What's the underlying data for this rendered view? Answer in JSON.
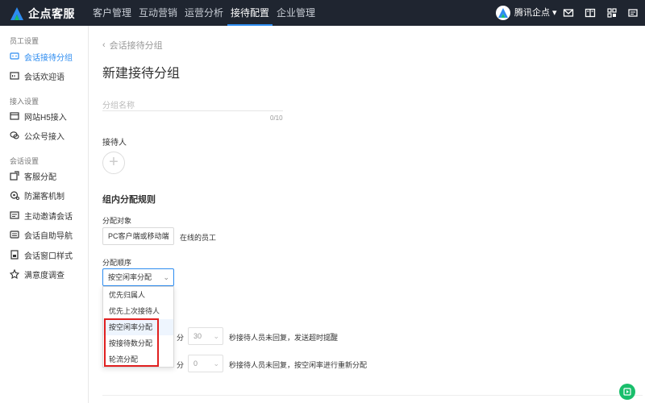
{
  "brand": "企点客服",
  "nav": [
    {
      "label": "客户管理",
      "active": false
    },
    {
      "label": "互动营销",
      "active": false
    },
    {
      "label": "运营分析",
      "active": false
    },
    {
      "label": "接待配置",
      "active": true
    },
    {
      "label": "企业管理",
      "active": false
    }
  ],
  "user": {
    "name": "腾讯企点 ▾"
  },
  "sidebar": {
    "sections": [
      {
        "title": "员工设置",
        "items": [
          {
            "label": "会话接待分组",
            "icon": "chat-group-icon",
            "active": true
          },
          {
            "label": "会话欢迎语",
            "icon": "welcome-message-icon",
            "active": false
          }
        ]
      },
      {
        "title": "接入设置",
        "items": [
          {
            "label": "网站H5接入",
            "icon": "website-icon",
            "active": false
          },
          {
            "label": "公众号接入",
            "icon": "wechat-icon",
            "active": false
          }
        ]
      },
      {
        "title": "会话设置",
        "items": [
          {
            "label": "客服分配",
            "icon": "assign-icon",
            "active": false
          },
          {
            "label": "防漏客机制",
            "icon": "leak-prevention-icon",
            "active": false
          },
          {
            "label": "主动邀请会话",
            "icon": "invite-icon",
            "active": false
          },
          {
            "label": "会话自助导航",
            "icon": "navigation-icon",
            "active": false
          },
          {
            "label": "会话窗口样式",
            "icon": "window-style-icon",
            "active": false
          },
          {
            "label": "满意度调查",
            "icon": "satisfaction-icon",
            "active": false
          }
        ]
      }
    ]
  },
  "main": {
    "back_label": "会话接待分组",
    "title": "新建接待分组",
    "group_name_placeholder": "分组名称",
    "group_name_counter": "0/10",
    "receptionist_label": "接待人",
    "rules_heading": "组内分配规则",
    "target_label": "分配对象",
    "target_value": "PC客户端或移动端",
    "target_suffix": "在线的员工",
    "order_label": "分配顺序",
    "order_value": "按空闲率分配",
    "order_options": [
      {
        "label": "优先归属人",
        "selected": false
      },
      {
        "label": "优先上次接待人",
        "selected": false
      },
      {
        "label": "按空闲率分配",
        "selected": true
      },
      {
        "label": "按接待数分配",
        "selected": false
      },
      {
        "label": "轮流分配",
        "selected": false
      }
    ],
    "row1": {
      "unit": "分",
      "value": "30",
      "text": "秒接待人员未回复，发送超时提醒"
    },
    "row2": {
      "unit": "分",
      "value": "0",
      "text": "秒接待人员未回复，按空闲率进行重新分配"
    }
  },
  "colors": {
    "nav_bg": "#1f2530",
    "accent": "#2d8cf0",
    "highlight_box": "#e02020",
    "float_button": "#19be6b"
  }
}
